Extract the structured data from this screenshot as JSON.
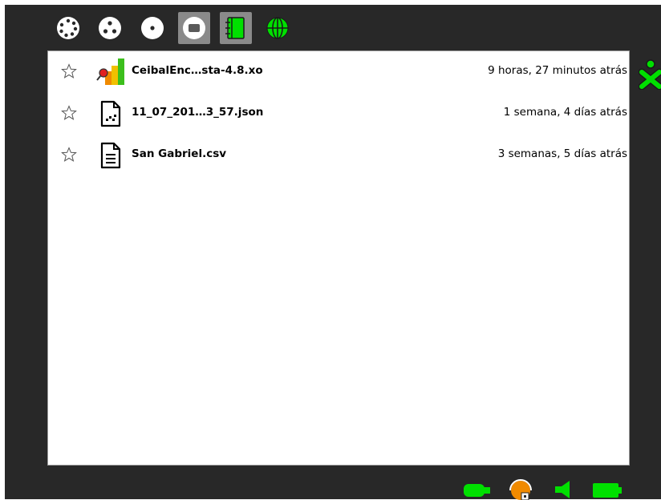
{
  "toolbar": {
    "zoom_buttons": [
      {
        "name": "neighborhood-view",
        "icon": "neighborhood-icon"
      },
      {
        "name": "group-view",
        "icon": "group-icon"
      },
      {
        "name": "home-view",
        "icon": "home-icon"
      },
      {
        "name": "activity-view",
        "icon": "activity-icon",
        "active": true
      },
      {
        "name": "journal",
        "icon": "journal-icon",
        "active": true
      },
      {
        "name": "browse-activity",
        "icon": "globe-icon"
      }
    ]
  },
  "journal": {
    "entries": [
      {
        "title": "CeibalEnc…sta-4.8.xo",
        "time": "9 horas, 27 minutos atrás",
        "icon": "activity-bundle-icon",
        "starred": false
      },
      {
        "title": "11_07_201…3_57.json",
        "time": "1 semana, 4 días atrás",
        "icon": "json-file-icon",
        "starred": false
      },
      {
        "title": "San Gabriel.csv",
        "time": "3 semanas, 5 días atrás",
        "icon": "text-file-icon",
        "starred": false
      }
    ]
  },
  "tray": {
    "icons": [
      "usb-drive-icon",
      "network-icon",
      "speaker-icon",
      "battery-icon"
    ]
  },
  "colors": {
    "frame": "#282828",
    "accent_green": "#00e000",
    "active_button": "#8a8a8a"
  }
}
